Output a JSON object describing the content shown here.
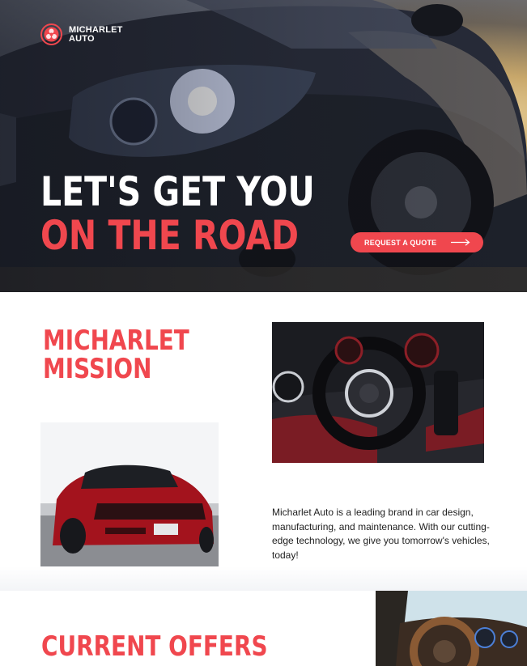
{
  "brand": {
    "name": "MICHARLET AUTO",
    "accent_color": "#f0474e",
    "logo_icon": "triple-blade-logo-icon"
  },
  "hero": {
    "headline_line1": "LET'S GET YOU",
    "headline_line2": "ON THE ROAD",
    "cta_label": "REQUEST A QUOTE",
    "cta_icon": "arrow-right-icon"
  },
  "mission": {
    "title_line1": "MICHARLET",
    "title_line2": "MISSION",
    "body": "Micharlet Auto is a leading brand in car design, manufacturing, and maintenance. With our cutting-edge technology, we give you tomorrow's vehicles, today!"
  },
  "offers": {
    "title": "CURRENT OFFERS"
  }
}
